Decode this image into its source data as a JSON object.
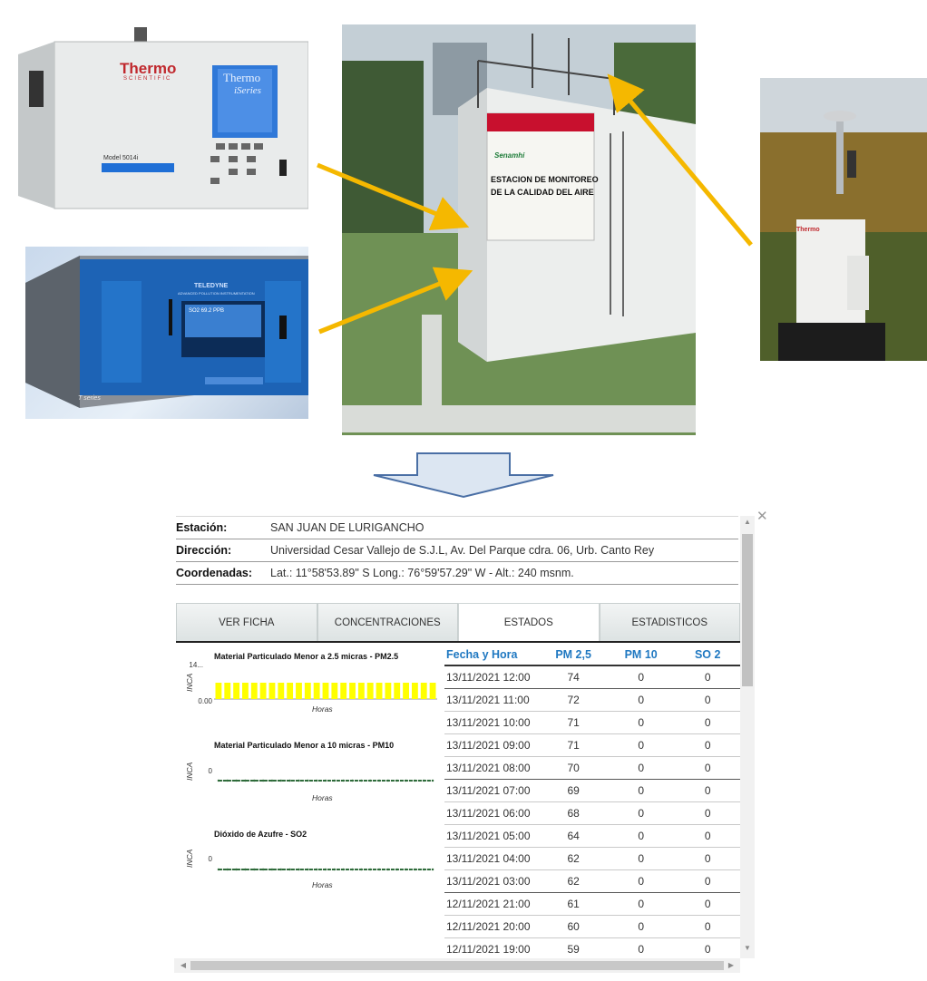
{
  "photos": {
    "thermo": {
      "brand": "Thermo",
      "sub": "SCIENTIFIC",
      "screen_brand": "Thermo",
      "screen_series": "iSeries",
      "model": "Model 5014i"
    },
    "teledyne": {
      "brand": "TELEDYNE",
      "sub": "ADVANCED POLLUTION INSTRUMENTATION",
      "series": "T series",
      "screen_reading": "SO2  69.2 PPB"
    },
    "station": {
      "sign_brand": "Senamhi",
      "sign_line1": "ESTACION DE MONITOREO",
      "sign_line2": "DE LA CALIDAD DEL AIRE"
    },
    "sampler": {
      "brand": "Thermo"
    }
  },
  "colors": {
    "arrow": "#f5b800",
    "down_arrow_fill": "#dce6f2",
    "down_arrow_stroke": "#4a6fa5",
    "tab_text": "#333333",
    "header_blue": "#1f78c1",
    "bar_yellow": "#ffff00",
    "flat_line": "#2e6b3a"
  },
  "panel": {
    "info": [
      {
        "label": "Estación:",
        "value": "SAN JUAN DE LURIGANCHO"
      },
      {
        "label": "Dirección:",
        "value": "Universidad Cesar Vallejo de S.J.L, Av. Del Parque cdra. 06, Urb. Canto Rey"
      },
      {
        "label": "Coordenadas:",
        "value": "Lat.: 11°58'53.89\" S Long.: 76°59'57.29\" W - Alt.: 240 msnm."
      }
    ],
    "tabs": [
      "VER FICHA",
      "CONCENTRACIONES",
      "ESTADOS",
      "ESTADISTICOS"
    ],
    "active_tab": "ESTADOS",
    "table": {
      "headers": [
        "Fecha y Hora",
        "PM 2,5",
        "PM 10",
        "SO 2"
      ],
      "rows": [
        [
          "13/11/2021 12:00",
          "74",
          "0",
          "0"
        ],
        [
          "13/11/2021 11:00",
          "72",
          "0",
          "0"
        ],
        [
          "13/11/2021 10:00",
          "71",
          "0",
          "0"
        ],
        [
          "13/11/2021 09:00",
          "71",
          "0",
          "0"
        ],
        [
          "13/11/2021 08:00",
          "70",
          "0",
          "0"
        ],
        [
          "13/11/2021 07:00",
          "69",
          "0",
          "0"
        ],
        [
          "13/11/2021 06:00",
          "68",
          "0",
          "0"
        ],
        [
          "13/11/2021 05:00",
          "64",
          "0",
          "0"
        ],
        [
          "13/11/2021 04:00",
          "62",
          "0",
          "0"
        ],
        [
          "13/11/2021 03:00",
          "62",
          "0",
          "0"
        ],
        [
          "12/11/2021 21:00",
          "61",
          "0",
          "0"
        ],
        [
          "12/11/2021 20:00",
          "60",
          "0",
          "0"
        ],
        [
          "12/11/2021 19:00",
          "59",
          "0",
          "0"
        ]
      ]
    }
  },
  "chart_data": [
    {
      "type": "bar",
      "title": "Material Particulado Menor a 2.5 micras - PM2.5",
      "xlabel": "Horas",
      "ylabel": "INCA",
      "yticks": [
        "14...",
        "0.00"
      ],
      "values": [
        1,
        1,
        1,
        1,
        1,
        1,
        1,
        1,
        1,
        1,
        1,
        1,
        1,
        1,
        1,
        1,
        1,
        1,
        1,
        1,
        1,
        1,
        1,
        1,
        1
      ],
      "ylim": [
        0,
        14
      ]
    },
    {
      "type": "line",
      "title": "Material Particulado Menor a 10 micras - PM10",
      "xlabel": "Horas",
      "ylabel": "INCA",
      "yticks": [
        "0"
      ],
      "values": [
        0,
        0,
        0,
        0,
        0,
        0,
        0,
        0,
        0,
        0,
        0,
        0,
        0,
        0,
        0,
        0,
        0,
        0,
        0,
        0,
        0,
        0,
        0,
        0,
        0
      ]
    },
    {
      "type": "line",
      "title": "Dióxido de Azufre - SO2",
      "xlabel": "Horas",
      "ylabel": "INCA",
      "yticks": [
        "0"
      ],
      "values": [
        0,
        0,
        0,
        0,
        0,
        0,
        0,
        0,
        0,
        0,
        0,
        0,
        0,
        0,
        0,
        0,
        0,
        0,
        0,
        0,
        0,
        0,
        0,
        0,
        0
      ]
    }
  ]
}
